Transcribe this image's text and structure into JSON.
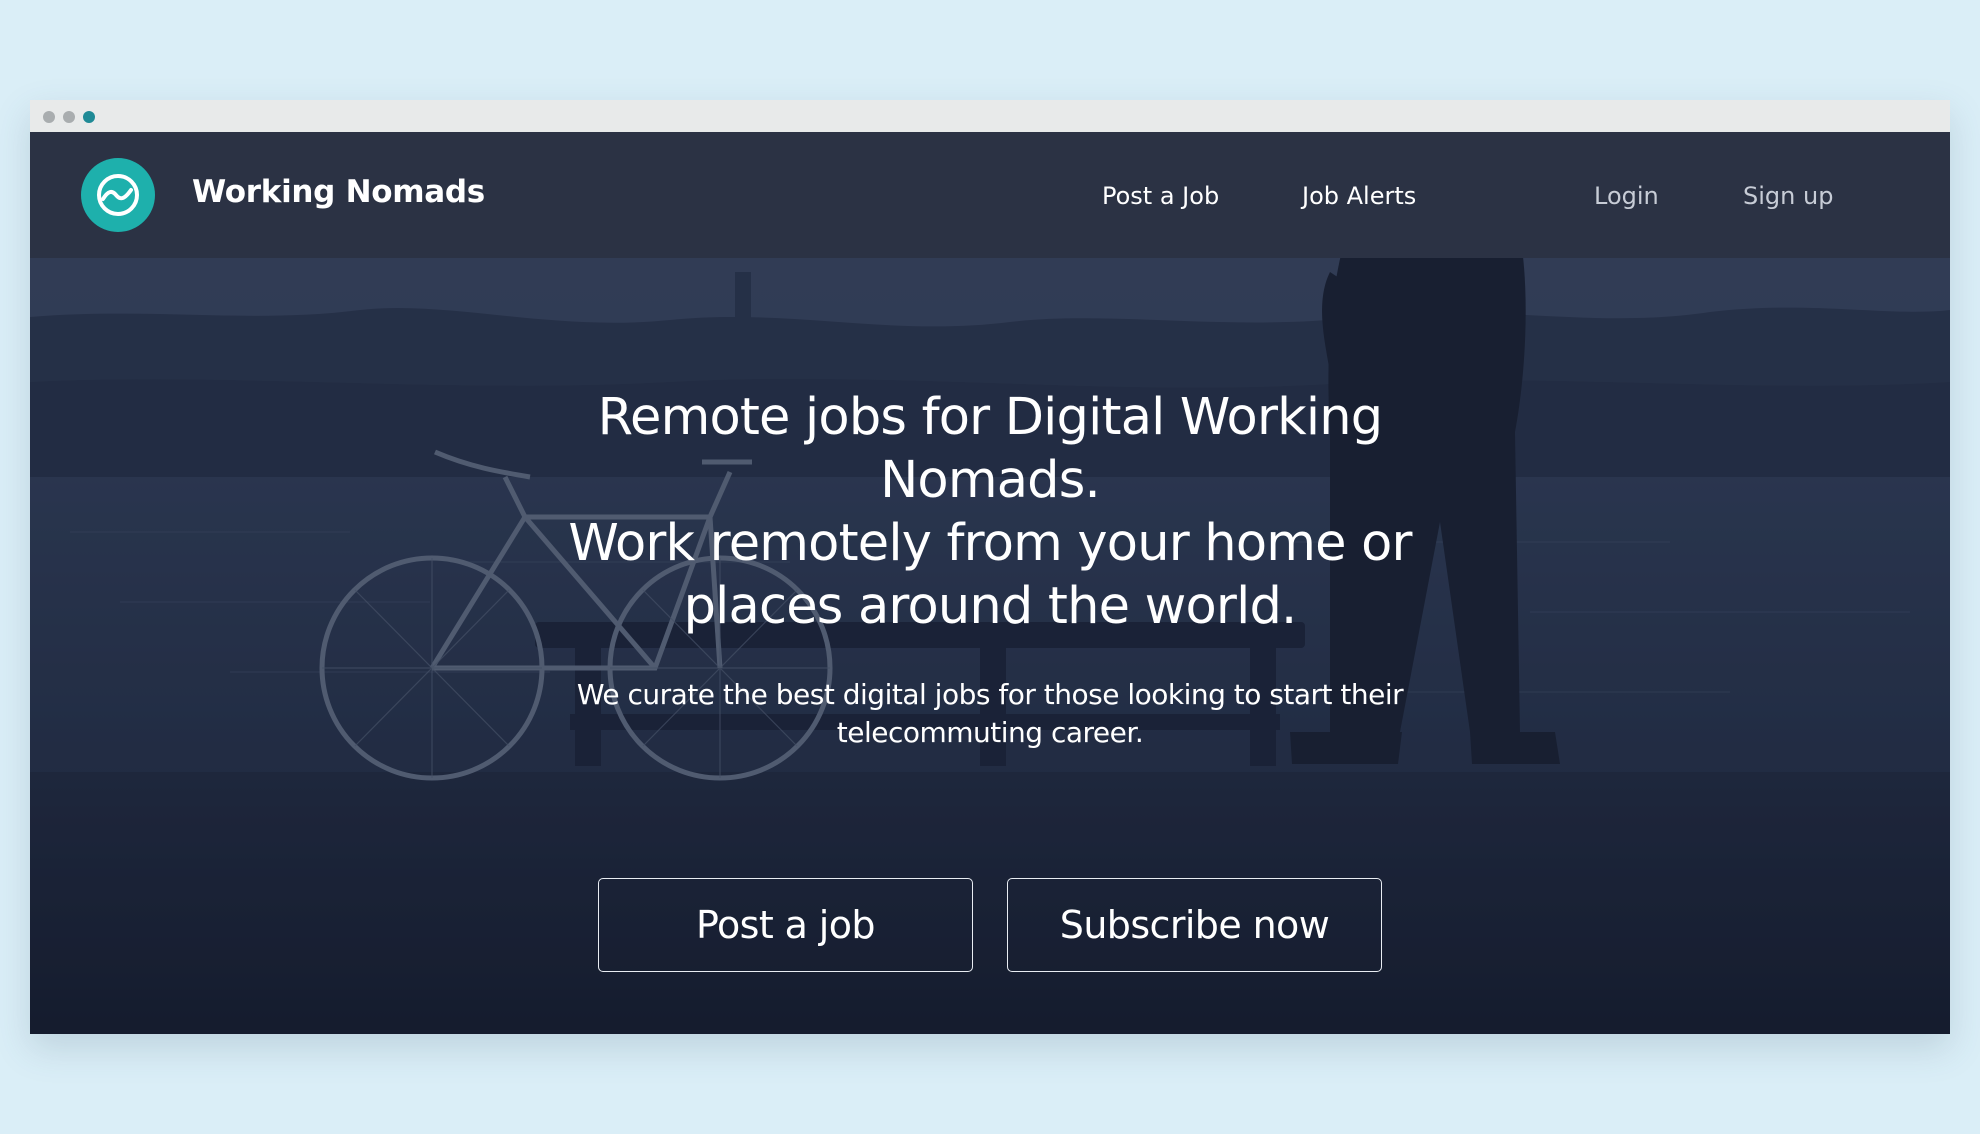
{
  "app": {
    "name": "Working Nomads",
    "logo_icon": "wave-icon",
    "accent_color": "#1eb0ac"
  },
  "nav": {
    "post_job": "Post a Job",
    "job_alerts": "Job Alerts",
    "login": "Login",
    "signup": "Sign up"
  },
  "hero": {
    "title_line1": "Remote jobs for Digital Working Nomads.",
    "title_line2": "Work remotely from your home or places around the world.",
    "subtitle": "We curate the best digital jobs for those looking to start their telecommuting career.",
    "background": "lakeside-bicycle-photo"
  },
  "cta": {
    "post_job": "Post a job",
    "subscribe": "Subscribe now"
  },
  "window": {
    "controls": [
      "close-dot",
      "minimize-dot",
      "maximize-dot"
    ]
  }
}
